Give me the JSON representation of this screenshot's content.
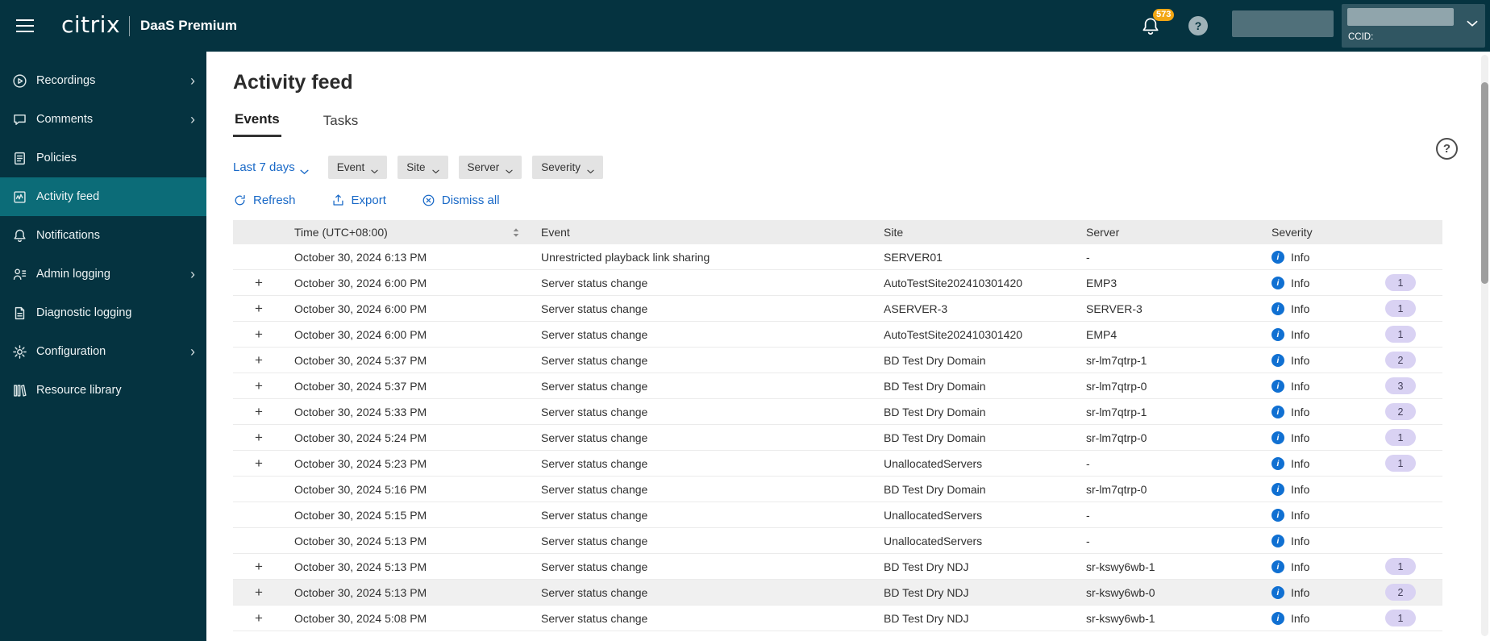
{
  "colors": {
    "teal": "#053340",
    "teal-selected": "#0c6c78",
    "accent": "#1969c7",
    "info": "#1070d2",
    "badge-bg": "#d9d2f3",
    "badge-text": "#44405a",
    "notify": "#f2a714"
  },
  "topbar": {
    "brand": "citrix",
    "product": "DaaS Premium",
    "notification_count": "573",
    "ccid_label": "CCID:"
  },
  "sidebar": {
    "items": [
      {
        "label": "Recordings",
        "icon": "recordings-icon",
        "expandable": true,
        "selected": false
      },
      {
        "label": "Comments",
        "icon": "comments-icon",
        "expandable": true,
        "selected": false
      },
      {
        "label": "Policies",
        "icon": "policies-icon",
        "expandable": false,
        "selected": false
      },
      {
        "label": "Activity feed",
        "icon": "activity-feed-icon",
        "expandable": false,
        "selected": true
      },
      {
        "label": "Notifications",
        "icon": "notifications-icon",
        "expandable": false,
        "selected": false
      },
      {
        "label": "Admin logging",
        "icon": "admin-logging-icon",
        "expandable": true,
        "selected": false
      },
      {
        "label": "Diagnostic logging",
        "icon": "diagnostic-logging-icon",
        "expandable": false,
        "selected": false
      },
      {
        "label": "Configuration",
        "icon": "configuration-icon",
        "expandable": true,
        "selected": false
      },
      {
        "label": "Resource library",
        "icon": "resource-library-icon",
        "expandable": false,
        "selected": false
      }
    ]
  },
  "main": {
    "title": "Activity feed",
    "tabs": [
      {
        "label": "Events",
        "active": true
      },
      {
        "label": "Tasks",
        "active": false
      }
    ],
    "filters": {
      "date_range": "Last 7 days",
      "dropdowns": [
        "Event",
        "Site",
        "Server",
        "Severity"
      ]
    },
    "actions": [
      {
        "label": "Refresh",
        "icon": "refresh-icon"
      },
      {
        "label": "Export",
        "icon": "export-icon"
      },
      {
        "label": "Dismiss all",
        "icon": "dismiss-icon"
      }
    ],
    "table": {
      "expand_symbol": "+",
      "columns": [
        "",
        "Time (UTC+08:00)",
        "Event",
        "Site",
        "Server",
        "Severity",
        ""
      ],
      "rows": [
        {
          "expandable": false,
          "time": "October 30, 2024 6:13 PM",
          "event": "Unrestricted playback link sharing",
          "site": "SERVER01",
          "server": "-",
          "severity": "Info",
          "count": ""
        },
        {
          "expandable": true,
          "time": "October 30, 2024 6:00 PM",
          "event": "Server status change",
          "site": "AutoTestSite202410301420",
          "server": "EMP3",
          "severity": "Info",
          "count": "1"
        },
        {
          "expandable": true,
          "time": "October 30, 2024 6:00 PM",
          "event": "Server status change",
          "site": "ASERVER-3",
          "server": "SERVER-3",
          "severity": "Info",
          "count": "1"
        },
        {
          "expandable": true,
          "time": "October 30, 2024 6:00 PM",
          "event": "Server status change",
          "site": "AutoTestSite202410301420",
          "server": "EMP4",
          "severity": "Info",
          "count": "1"
        },
        {
          "expandable": true,
          "time": "October 30, 2024 5:37 PM",
          "event": "Server status change",
          "site": "BD Test Dry Domain",
          "server": "sr-lm7qtrp-1",
          "severity": "Info",
          "count": "2"
        },
        {
          "expandable": true,
          "time": "October 30, 2024 5:37 PM",
          "event": "Server status change",
          "site": "BD Test Dry Domain",
          "server": "sr-lm7qtrp-0",
          "severity": "Info",
          "count": "3"
        },
        {
          "expandable": true,
          "time": "October 30, 2024 5:33 PM",
          "event": "Server status change",
          "site": "BD Test Dry Domain",
          "server": "sr-lm7qtrp-1",
          "severity": "Info",
          "count": "2"
        },
        {
          "expandable": true,
          "time": "October 30, 2024 5:24 PM",
          "event": "Server status change",
          "site": "BD Test Dry Domain",
          "server": "sr-lm7qtrp-0",
          "severity": "Info",
          "count": "1"
        },
        {
          "expandable": true,
          "time": "October 30, 2024 5:23 PM",
          "event": "Server status change",
          "site": "UnallocatedServers",
          "server": "-",
          "severity": "Info",
          "count": "1"
        },
        {
          "expandable": false,
          "time": "October 30, 2024 5:16 PM",
          "event": "Server status change",
          "site": "BD Test Dry Domain",
          "server": "sr-lm7qtrp-0",
          "severity": "Info",
          "count": ""
        },
        {
          "expandable": false,
          "time": "October 30, 2024 5:15 PM",
          "event": "Server status change",
          "site": "UnallocatedServers",
          "server": "-",
          "severity": "Info",
          "count": ""
        },
        {
          "expandable": false,
          "time": "October 30, 2024 5:13 PM",
          "event": "Server status change",
          "site": "UnallocatedServers",
          "server": "-",
          "severity": "Info",
          "count": ""
        },
        {
          "expandable": true,
          "time": "October 30, 2024 5:13 PM",
          "event": "Server status change",
          "site": "BD Test Dry NDJ",
          "server": "sr-kswy6wb-1",
          "severity": "Info",
          "count": "1"
        },
        {
          "expandable": true,
          "time": "October 30, 2024 5:13 PM",
          "event": "Server status change",
          "site": "BD Test Dry NDJ",
          "server": "sr-kswy6wb-0",
          "severity": "Info",
          "count": "2",
          "highlight": true
        },
        {
          "expandable": true,
          "time": "October 30, 2024 5:08 PM",
          "event": "Server status change",
          "site": "BD Test Dry NDJ",
          "server": "sr-kswy6wb-1",
          "severity": "Info",
          "count": "1"
        }
      ]
    }
  }
}
